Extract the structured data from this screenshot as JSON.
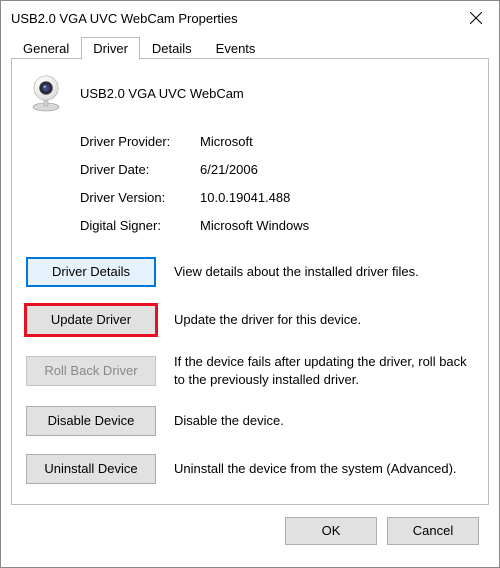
{
  "titlebar": {
    "title": "USB2.0 VGA UVC WebCam Properties"
  },
  "tabs": {
    "general": "General",
    "driver": "Driver",
    "details": "Details",
    "events": "Events"
  },
  "device": {
    "name": "USB2.0 VGA UVC WebCam"
  },
  "info": {
    "provider_label": "Driver Provider:",
    "provider_value": "Microsoft",
    "date_label": "Driver Date:",
    "date_value": "6/21/2006",
    "version_label": "Driver Version:",
    "version_value": "10.0.19041.488",
    "signer_label": "Digital Signer:",
    "signer_value": "Microsoft Windows"
  },
  "actions": {
    "details_btn": "Driver Details",
    "details_desc": "View details about the installed driver files.",
    "update_btn": "Update Driver",
    "update_desc": "Update the driver for this device.",
    "rollback_btn": "Roll Back Driver",
    "rollback_desc": "If the device fails after updating the driver, roll back to the previously installed driver.",
    "disable_btn": "Disable Device",
    "disable_desc": "Disable the device.",
    "uninstall_btn": "Uninstall Device",
    "uninstall_desc": "Uninstall the device from the system (Advanced)."
  },
  "dialog": {
    "ok": "OK",
    "cancel": "Cancel"
  }
}
